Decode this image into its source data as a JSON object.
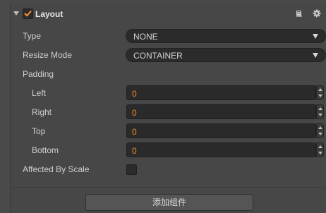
{
  "component": {
    "title": "Layout",
    "enabled": true,
    "icons": {
      "collapse": "triangle-down-icon",
      "doc": "book-icon",
      "settings": "gear-icon"
    }
  },
  "properties": {
    "type": {
      "label": "Type",
      "value": "NONE"
    },
    "resize_mode": {
      "label": "Resize Mode",
      "value": "CONTAINER"
    },
    "padding": {
      "label": "Padding",
      "left": {
        "label": "Left",
        "value": "0"
      },
      "right": {
        "label": "Right",
        "value": "0"
      },
      "top": {
        "label": "Top",
        "value": "0"
      },
      "bottom": {
        "label": "Bottom",
        "value": "0"
      }
    },
    "affected_by_scale": {
      "label": "Affected By Scale",
      "checked": false
    }
  },
  "footer": {
    "add_component_label": "添加组件"
  },
  "colors": {
    "accent": "#f08c2a",
    "panel_bg": "#474747",
    "field_bg": "#2b2b2b"
  }
}
